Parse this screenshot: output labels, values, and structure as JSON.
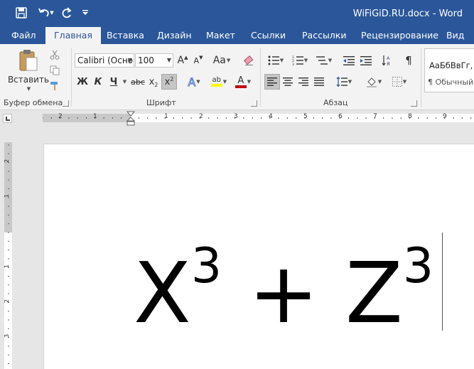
{
  "titlebar": {
    "doc_title": "WiFiGiD.RU.docx - Word",
    "save_icon": "save-icon",
    "undo_icon": "undo-icon",
    "redo_icon": "redo-icon"
  },
  "tabs": [
    {
      "label": "Файл"
    },
    {
      "label": "Главная"
    },
    {
      "label": "Вставка"
    },
    {
      "label": "Дизайн"
    },
    {
      "label": "Макет"
    },
    {
      "label": "Ссылки"
    },
    {
      "label": "Рассылки"
    },
    {
      "label": "Рецензирование"
    },
    {
      "label": "Вид"
    }
  ],
  "ribbon": {
    "clipboard": {
      "group_label": "Буфер обмена",
      "paste_label": "Вставить"
    },
    "font": {
      "group_label": "Шрифт",
      "font_name": "Calibri (Осно",
      "font_size": "100",
      "bold": "Ж",
      "italic": "К",
      "underline": "Ч",
      "strike": "abc",
      "change_case": "Aa",
      "grow": "A",
      "shrink": "A",
      "text_effects": "A",
      "font_color": "A",
      "highlight": "ab",
      "subscript": "x",
      "subscript_mark": "2",
      "superscript": "x",
      "superscript_mark": "2"
    },
    "paragraph": {
      "group_label": "Абзац",
      "show_marks": "¶"
    },
    "styles": {
      "sample": "АаБбВвГг,",
      "name": "¶ Обычный"
    }
  },
  "ruler": {
    "h_labels": [
      "2",
      "1",
      "1",
      "2",
      "3",
      "4",
      "5",
      "6",
      "7",
      "8",
      "9"
    ],
    "v_labels": [
      "2",
      "1",
      "1",
      "2",
      "3"
    ]
  },
  "document": {
    "base1": "X",
    "exp1": "3",
    "operator": "+",
    "base2": "Z",
    "exp2": "3"
  },
  "colors": {
    "accent": "#2b579a",
    "font_color": "#c00000",
    "highlight": "#ffff00"
  }
}
